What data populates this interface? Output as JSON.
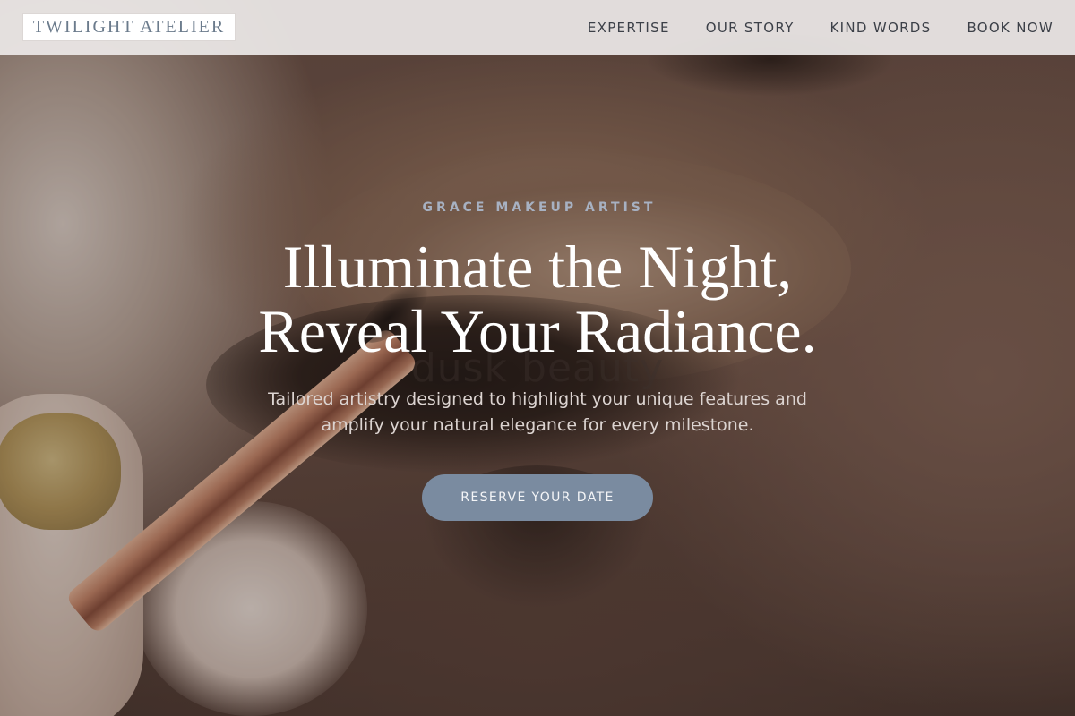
{
  "brand": {
    "name": "TWILIGHT ATELIER",
    "color": "#6b7b8c"
  },
  "nav": {
    "items": [
      {
        "label": "EXPERTISE"
      },
      {
        "label": "OUR STORY"
      },
      {
        "label": "KIND WORDS"
      },
      {
        "label": "BOOK NOW"
      }
    ]
  },
  "hero": {
    "eyebrow": "GRACE MAKEUP ARTIST",
    "headline_line1": "Illuminate the Night,",
    "headline_line2": "Reveal Your Radiance.",
    "watermark": "dusk beauty",
    "subtext_line1": "Tailored artistry designed to highlight your unique features and",
    "subtext_line2": "amplify your natural elegance for every milestone.",
    "cta_label": "RESERVE YOUR DATE",
    "image_description_icon": "makeup-brush-eye-photo"
  },
  "colors": {
    "accent": "#7a8ba0",
    "eyebrow": "#a7b1c2",
    "header_bg": "#ece8e7"
  }
}
